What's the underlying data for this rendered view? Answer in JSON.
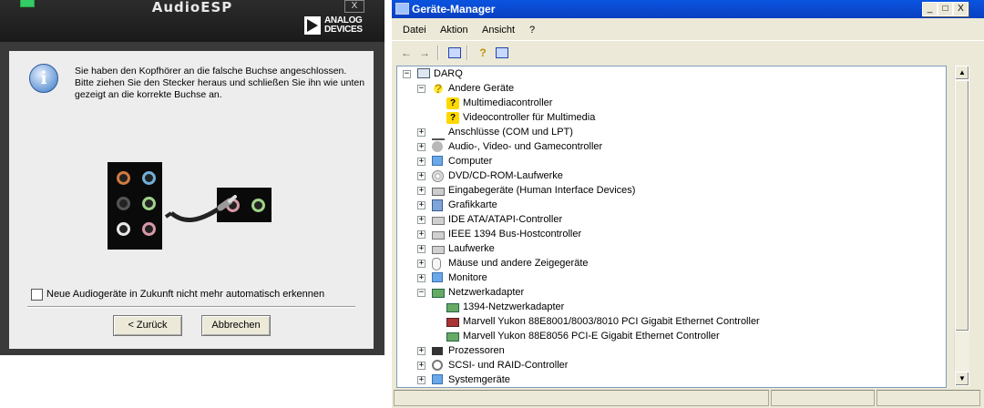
{
  "audioesp": {
    "title": "AudioESP",
    "close": "X",
    "logo_line1": "ANALOG",
    "logo_line2": "DEVICES",
    "info_icon": "i",
    "message": "Sie haben den Kopfhörer an die falsche Buchse angeschlossen. Bitte ziehen Sie den Stecker heraus und schließen Sie ihn wie unten gezeigt an die korrekte Buchse an.",
    "checkbox_label": "Neue Audiogeräte in Zukunft nicht mehr automatisch erkennen",
    "checkbox_checked": false,
    "back_button": "< Zurück",
    "cancel_button": "Abbrechen",
    "jack_colors": [
      "#d07a40",
      "#6fb0d8",
      "#555555",
      "#9fd28a",
      "#e8e8e8",
      "#d898a8"
    ],
    "jack_colors_2": [
      "#d898a8",
      "#9fd28a"
    ]
  },
  "devmgr": {
    "title": "Geräte-Manager",
    "controls": {
      "minimize": "_",
      "maximize": "□",
      "close": "X"
    },
    "menu": [
      "Datei",
      "Aktion",
      "Ansicht",
      "?"
    ],
    "toolbar_icons": [
      "back-arrow-icon",
      "forward-arrow-icon",
      "properties-icon",
      "help-icon",
      "view-icon"
    ],
    "tree": [
      {
        "label": "DARQ",
        "level": 0,
        "expander": "-",
        "icon": "computer"
      },
      {
        "label": "Andere Geräte",
        "level": 1,
        "expander": "-",
        "icon": "qmark"
      },
      {
        "label": "Multimediacontroller",
        "level": 2,
        "expander": "",
        "icon": "yellowq"
      },
      {
        "label": "Videocontroller für Multimedia",
        "level": 2,
        "expander": "",
        "icon": "yellowq"
      },
      {
        "label": "Anschlüsse (COM und LPT)",
        "level": 1,
        "expander": "+",
        "icon": "plug"
      },
      {
        "label": "Audio-, Video- und Gamecontroller",
        "level": 1,
        "expander": "+",
        "icon": "speaker"
      },
      {
        "label": "Computer",
        "level": 1,
        "expander": "+",
        "icon": "monitor"
      },
      {
        "label": "DVD/CD-ROM-Laufwerke",
        "level": 1,
        "expander": "+",
        "icon": "disc"
      },
      {
        "label": "Eingabegeräte (Human Interface Devices)",
        "level": 1,
        "expander": "+",
        "icon": "keyboard"
      },
      {
        "label": "Grafikkarte",
        "level": 1,
        "expander": "+",
        "icon": "gfx"
      },
      {
        "label": "IDE ATA/ATAPI-Controller",
        "level": 1,
        "expander": "+",
        "icon": "drive"
      },
      {
        "label": "IEEE 1394 Bus-Hostcontroller",
        "level": 1,
        "expander": "+",
        "icon": "drive"
      },
      {
        "label": "Laufwerke",
        "level": 1,
        "expander": "+",
        "icon": "drive"
      },
      {
        "label": "Mäuse und andere Zeigegeräte",
        "level": 1,
        "expander": "+",
        "icon": "mouse"
      },
      {
        "label": "Monitore",
        "level": 1,
        "expander": "+",
        "icon": "monitor"
      },
      {
        "label": "Netzwerkadapter",
        "level": 1,
        "expander": "-",
        "icon": "card"
      },
      {
        "label": "1394-Netzwerkadapter",
        "level": 2,
        "expander": "",
        "icon": "card"
      },
      {
        "label": "Marvell Yukon 88E8001/8003/8010 PCI Gigabit Ethernet Controller",
        "level": 2,
        "expander": "",
        "icon": "cardred"
      },
      {
        "label": "Marvell Yukon 88E8056 PCI-E Gigabit Ethernet Controller",
        "level": 2,
        "expander": "",
        "icon": "card"
      },
      {
        "label": "Prozessoren",
        "level": 1,
        "expander": "+",
        "icon": "cpu"
      },
      {
        "label": "SCSI- und RAID-Controller",
        "level": 1,
        "expander": "+",
        "icon": "scsi"
      },
      {
        "label": "Systemgeräte",
        "level": 1,
        "expander": "+",
        "icon": "monitor"
      }
    ]
  }
}
